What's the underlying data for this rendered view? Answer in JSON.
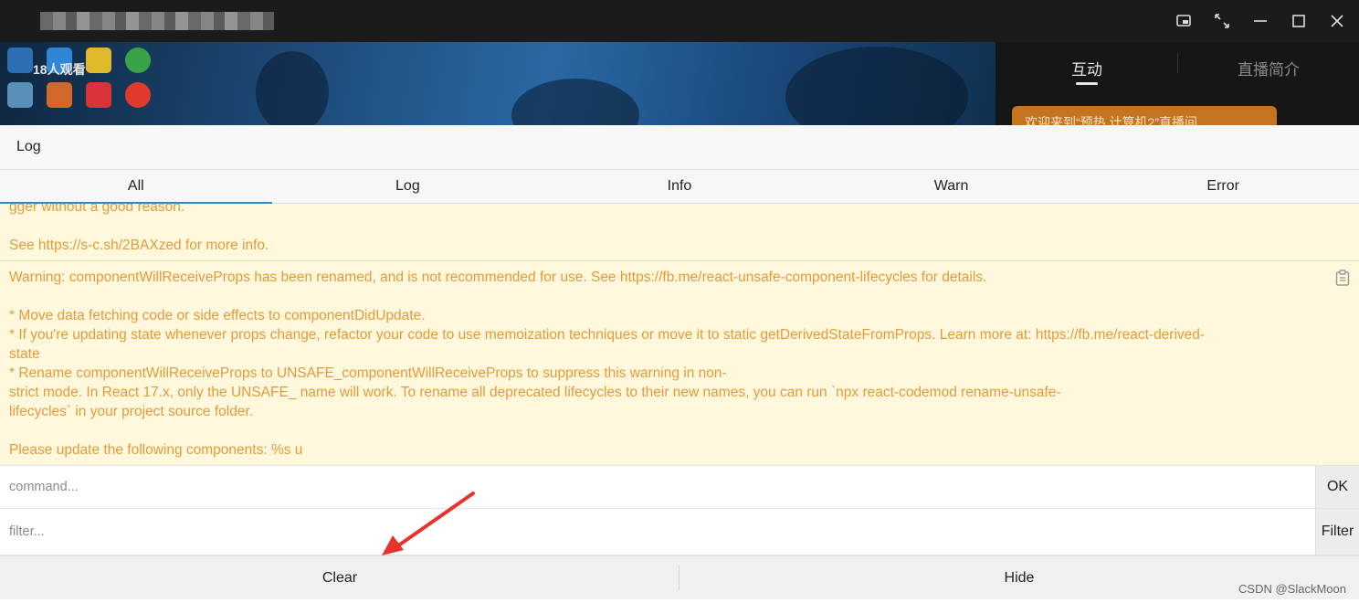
{
  "window": {
    "controls": [
      "pip-icon",
      "fullscreen-icon",
      "minimize-icon",
      "maximize-icon",
      "close-icon"
    ]
  },
  "video": {
    "watch_count": "18人观看"
  },
  "side_panel": {
    "tabs": [
      "互动",
      "直播简介"
    ],
    "active_tab": "互动",
    "banner_text": "欢迎来到“预热 计算机2”直播间"
  },
  "console": {
    "title": "Log",
    "tabs": [
      {
        "label": "All",
        "active": true
      },
      {
        "label": "Log",
        "active": false
      },
      {
        "label": "Info",
        "active": false
      },
      {
        "label": "Warn",
        "active": false
      },
      {
        "label": "Error",
        "active": false
      }
    ],
    "logs": [
      {
        "level": "warn",
        "lines": [
          "gger without a good reason.",
          "",
          "See https://s-c.sh/2BAXzed for more info."
        ]
      },
      {
        "level": "warn",
        "lines": [
          "Warning: componentWillReceiveProps has been renamed, and is not recommended for use. See https://fb.me/react-unsafe-component-lifecycles for details.",
          "",
          "* Move data fetching code or side effects to componentDidUpdate.",
          "* If you're updating state whenever props change, refactor your code to use memoization techniques or move it to static getDerivedStateFromProps. Learn more at: https://fb.me/react-derived-",
          "state",
          "* Rename componentWillReceiveProps to UNSAFE_componentWillReceiveProps to suppress this warning in non-",
          "strict mode. In React 17.x, only the UNSAFE_ name will work. To rename all deprecated lifecycles to their new names, you can run `npx react-codemod rename-unsafe-",
          "lifecycles` in your project source folder.",
          "",
          "Please update the following components: %s u"
        ]
      }
    ],
    "command": {
      "value": "",
      "placeholder": "command...",
      "button": "OK"
    },
    "filter": {
      "value": "",
      "placeholder": "filter...",
      "button": "Filter"
    },
    "footer": {
      "clear": "Clear",
      "hide": "Hide"
    },
    "colors": {
      "warn_text": "#e59a3a",
      "warn_bg": "#fff8dc",
      "tab_accent": "#2f89c9"
    }
  },
  "watermark": "CSDN @SlackMoon"
}
